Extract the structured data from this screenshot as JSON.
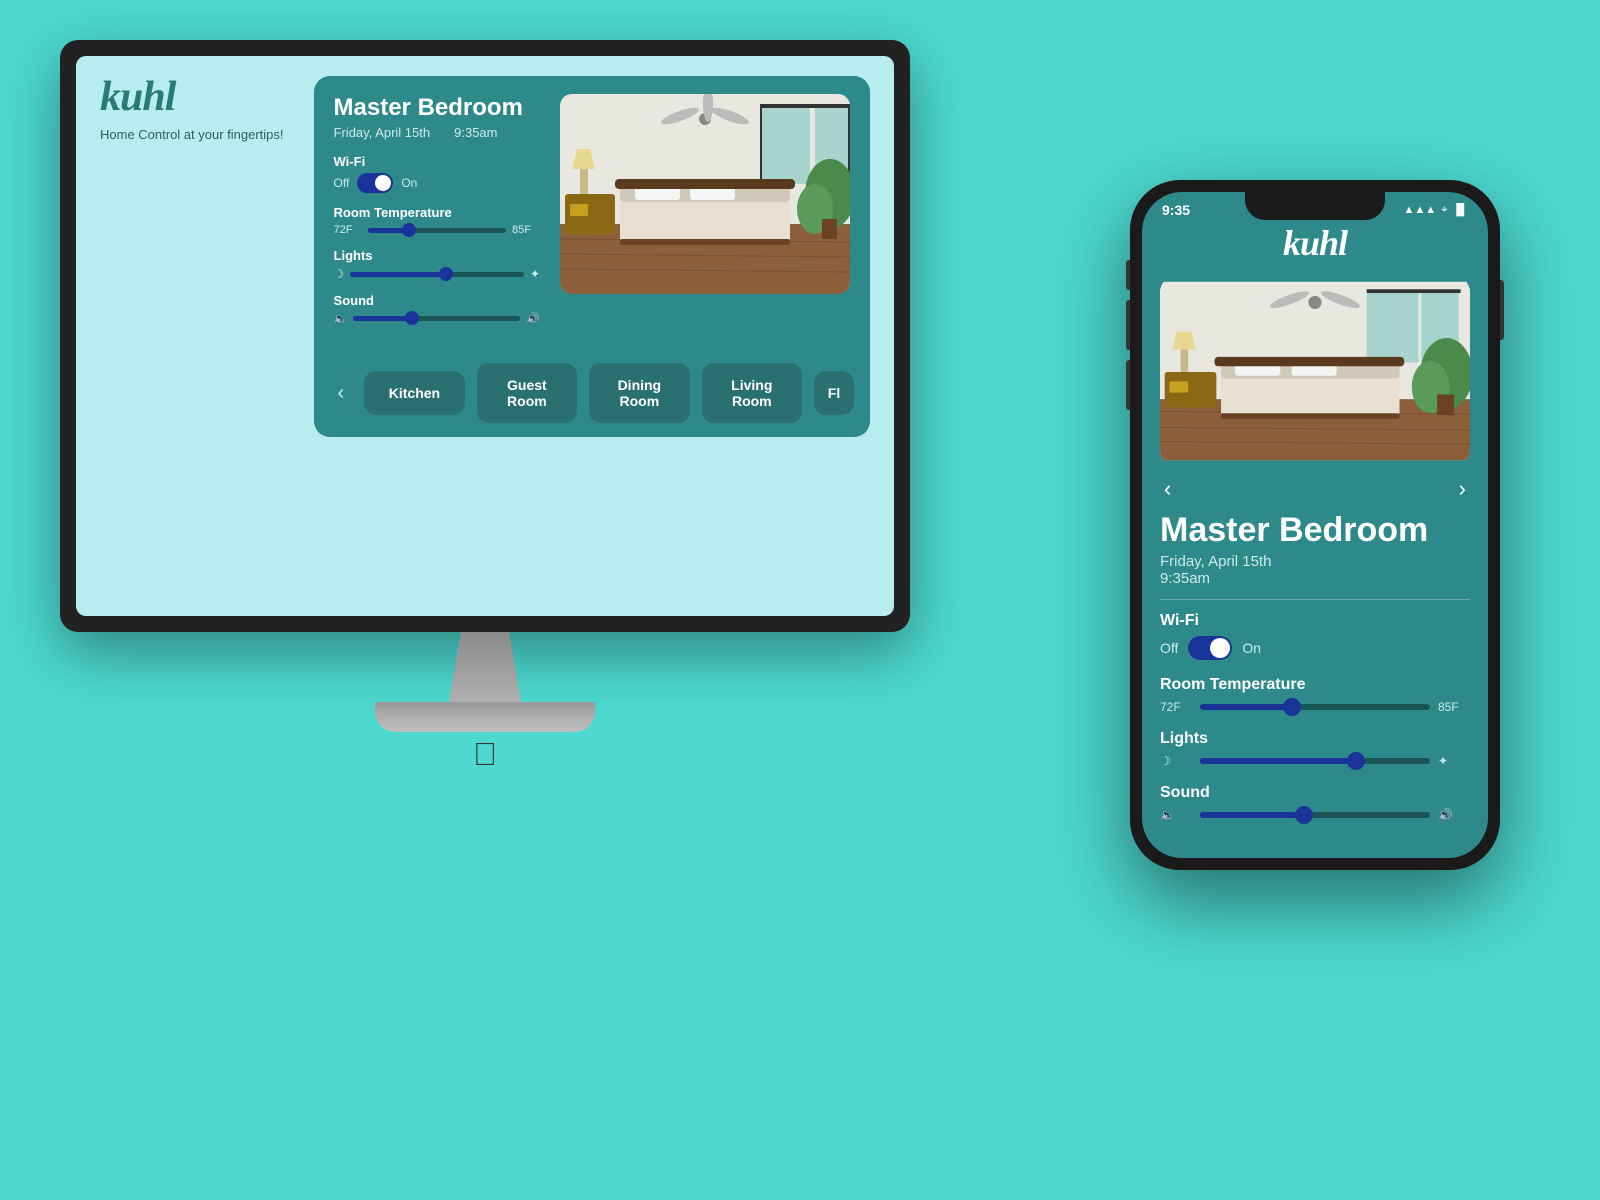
{
  "brand": {
    "name": "kuhl",
    "tagline": "Home Control\nat your\nfingertips!"
  },
  "desktop": {
    "room": {
      "title": "Master Bedroom",
      "date": "Friday, April 15th",
      "time": "9:35am"
    },
    "wifi": {
      "label": "Wi-Fi",
      "off_label": "Off",
      "on_label": "On",
      "state": "on"
    },
    "temperature": {
      "label": "Room Temperature",
      "min": "72F",
      "max": "85F",
      "value_pct": 30
    },
    "lights": {
      "label": "Lights",
      "value_pct": 55
    },
    "sound": {
      "label": "Sound",
      "value_pct": 35
    },
    "rooms": [
      "Kitchen",
      "Guest Room",
      "Dining Room",
      "Living Room",
      "Fl"
    ]
  },
  "mobile": {
    "status_bar": {
      "time": "9:35",
      "signal": "▲▲▲",
      "wifi": "WiFi",
      "battery": "🔋"
    },
    "brand": "kuhl",
    "room": {
      "title": "Master Bedroom",
      "date": "Friday, April 15th",
      "time": "9:35am"
    },
    "wifi": {
      "label": "Wi-Fi",
      "off_label": "Off",
      "on_label": "On",
      "state": "on"
    },
    "temperature": {
      "label": "Room Temperature",
      "min": "72F",
      "max": "85F",
      "value_pct": 40
    },
    "lights": {
      "label": "Lights",
      "value_pct": 68
    },
    "sound": {
      "label": "Sound",
      "value_pct": 45
    }
  }
}
